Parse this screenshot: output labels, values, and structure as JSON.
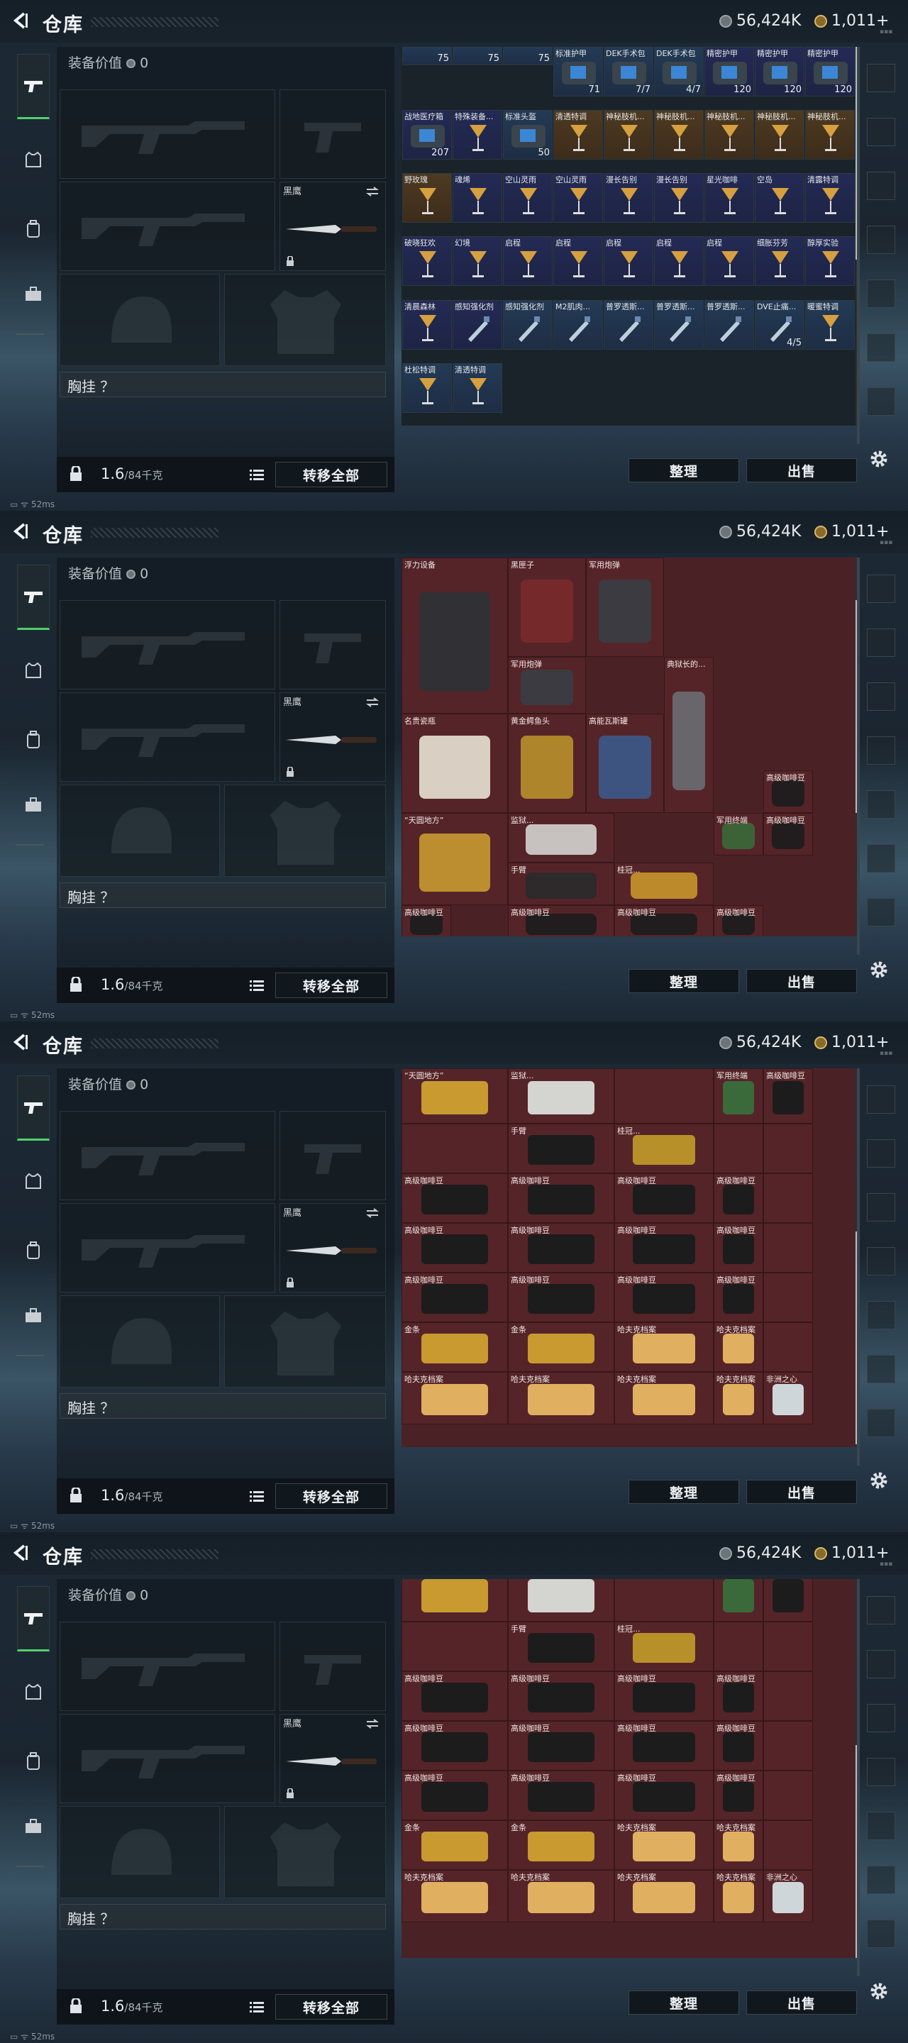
{
  "header": {
    "title": "仓库",
    "silver": "56,424K",
    "gold": "1,011+"
  },
  "equip": {
    "value_label": "装备价值",
    "value": "0",
    "knife_label": "黑鹰",
    "chest_label": "胸挂 ？",
    "weight": "1.6",
    "weight_max": "/84千克",
    "transfer_all": "转移全部"
  },
  "actions": {
    "sort": "整理",
    "sell": "出售"
  },
  "status": {
    "ping": "52ms"
  },
  "screen1_items": [
    {
      "name": "",
      "count": "75",
      "style": "blue"
    },
    {
      "name": "",
      "count": "75",
      "style": "blue"
    },
    {
      "name": "",
      "count": "75",
      "style": "blue"
    },
    {
      "name": "标准护甲",
      "count": "71",
      "style": "blue"
    },
    {
      "name": "DEK手术包",
      "count": "7/7",
      "style": "blue"
    },
    {
      "name": "DEK手术包",
      "count": "4/7",
      "style": "blue"
    },
    {
      "name": "精密护甲",
      "count": "120",
      "style": "purple"
    },
    {
      "name": "精密护甲",
      "count": "120",
      "style": "purple"
    },
    {
      "name": "精密护甲",
      "count": "120",
      "style": "purple"
    },
    {
      "name": "战地医疗箱",
      "count": "207",
      "style": "purple"
    },
    {
      "name": "特殊装备...",
      "count": "",
      "style": "purple"
    },
    {
      "name": "标准头盔",
      "count": "50",
      "style": "blue"
    },
    {
      "name": "清透特调",
      "count": "",
      "style": "gold"
    },
    {
      "name": "神秘肢机...",
      "count": "",
      "style": "gold"
    },
    {
      "name": "神秘肢机...",
      "count": "",
      "style": "gold"
    },
    {
      "name": "神秘肢机...",
      "count": "",
      "style": "gold"
    },
    {
      "name": "神秘肢机...",
      "count": "",
      "style": "gold"
    },
    {
      "name": "神秘肢机...",
      "count": "",
      "style": "gold"
    },
    {
      "name": "野玫瑰",
      "count": "",
      "style": "gold"
    },
    {
      "name": "魂烯",
      "count": "",
      "style": "purple"
    },
    {
      "name": "空山灵雨",
      "count": "",
      "style": "purple"
    },
    {
      "name": "空山灵雨",
      "count": "",
      "style": "purple"
    },
    {
      "name": "漫长告别",
      "count": "",
      "style": "purple"
    },
    {
      "name": "漫长告别",
      "count": "",
      "style": "purple"
    },
    {
      "name": "星光咖啡",
      "count": "",
      "style": "purple"
    },
    {
      "name": "空岛",
      "count": "",
      "style": "purple"
    },
    {
      "name": "清露特调",
      "count": "",
      "style": "purple"
    },
    {
      "name": "破晓狂欢",
      "count": "",
      "style": "purple"
    },
    {
      "name": "幻境",
      "count": "",
      "style": "purple"
    },
    {
      "name": "启程",
      "count": "",
      "style": "purple"
    },
    {
      "name": "启程",
      "count": "",
      "style": "purple"
    },
    {
      "name": "启程",
      "count": "",
      "style": "purple"
    },
    {
      "name": "启程",
      "count": "",
      "style": "purple"
    },
    {
      "name": "启程",
      "count": "",
      "style": "purple"
    },
    {
      "name": "细胀芬芳",
      "count": "",
      "style": "purple"
    },
    {
      "name": "醇厚实验",
      "count": "",
      "style": "purple"
    },
    {
      "name": "清晨森林",
      "count": "",
      "style": "purple"
    },
    {
      "name": "感知强化剂",
      "count": "",
      "style": "purple"
    },
    {
      "name": "感知强化剂",
      "count": "",
      "style": "blue"
    },
    {
      "name": "M2肌肉...",
      "count": "",
      "style": "blue"
    },
    {
      "name": "普罗透斯...",
      "count": "",
      "style": "blue"
    },
    {
      "name": "普罗透斯...",
      "count": "",
      "style": "blue"
    },
    {
      "name": "普罗透斯...",
      "count": "",
      "style": "blue"
    },
    {
      "name": "DVE止痛...",
      "count": "4/5",
      "style": "blue"
    },
    {
      "name": "暖蜜特调",
      "count": "",
      "style": "blue"
    },
    {
      "name": "杜松特调",
      "count": "",
      "style": "blue"
    },
    {
      "name": "清透特调",
      "count": "",
      "style": "blue"
    }
  ],
  "screen2_items": [
    {
      "name": "浮力设备"
    },
    {
      "name": "黑匣子"
    },
    {
      "name": "军用炮弹"
    },
    {
      "name": "军用炮弹"
    },
    {
      "name": "名贵瓷瓶"
    },
    {
      "name": "黄金鳄鱼头"
    },
    {
      "name": "高能瓦斯罐"
    },
    {
      "name": "典狱长的..."
    },
    {
      "name": "“天圆地方”"
    },
    {
      "name": "监狱..."
    },
    {
      "name": "手臂"
    },
    {
      "name": "桂冠..."
    },
    {
      "name": "军用终端"
    },
    {
      "name": "高级咖啡豆"
    },
    {
      "name": "高级咖啡豆"
    },
    {
      "name": "高级咖啡豆"
    },
    {
      "name": "高级咖啡豆"
    },
    {
      "name": "高级咖啡豆"
    },
    {
      "name": "高级咖啡豆"
    }
  ],
  "screen3_rows": [
    [
      "“天圆地方”",
      "监狱...",
      "",
      "军用终端",
      "高级咖啡豆"
    ],
    [
      "",
      "手臂",
      "桂冠...",
      "",
      ""
    ],
    [
      "高级咖啡豆",
      "高级咖啡豆",
      "高级咖啡豆",
      "高级咖啡豆",
      ""
    ],
    [
      "高级咖啡豆",
      "高级咖啡豆",
      "高级咖啡豆",
      "高级咖啡豆",
      ""
    ],
    [
      "高级咖啡豆",
      "高级咖啡豆",
      "高级咖啡豆",
      "高级咖啡豆",
      ""
    ],
    [
      "金条",
      "金条",
      "哈夫克档案",
      "哈夫克档案",
      ""
    ],
    [
      "哈夫克档案",
      "哈夫克档案",
      "哈夫克档案",
      "哈夫克档案",
      "非洲之心"
    ]
  ]
}
